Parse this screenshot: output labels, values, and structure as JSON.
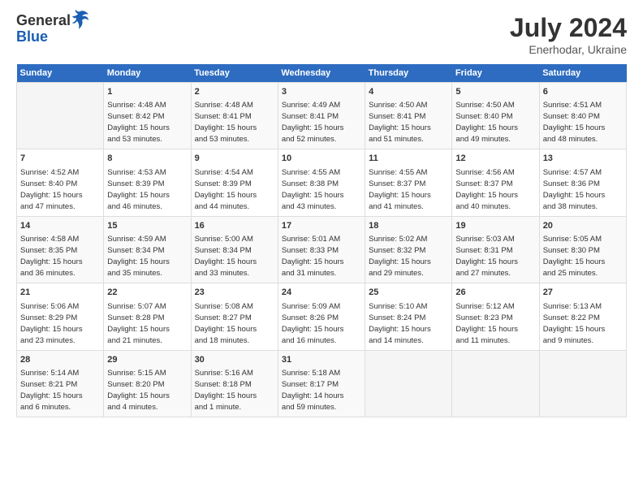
{
  "logo": {
    "general": "General",
    "blue": "Blue"
  },
  "title": "July 2024",
  "subtitle": "Enerhodar, Ukraine",
  "days_header": [
    "Sunday",
    "Monday",
    "Tuesday",
    "Wednesday",
    "Thursday",
    "Friday",
    "Saturday"
  ],
  "weeks": [
    [
      {
        "day": "",
        "detail": ""
      },
      {
        "day": "1",
        "detail": "Sunrise: 4:48 AM\nSunset: 8:42 PM\nDaylight: 15 hours\nand 53 minutes."
      },
      {
        "day": "2",
        "detail": "Sunrise: 4:48 AM\nSunset: 8:41 PM\nDaylight: 15 hours\nand 53 minutes."
      },
      {
        "day": "3",
        "detail": "Sunrise: 4:49 AM\nSunset: 8:41 PM\nDaylight: 15 hours\nand 52 minutes."
      },
      {
        "day": "4",
        "detail": "Sunrise: 4:50 AM\nSunset: 8:41 PM\nDaylight: 15 hours\nand 51 minutes."
      },
      {
        "day": "5",
        "detail": "Sunrise: 4:50 AM\nSunset: 8:40 PM\nDaylight: 15 hours\nand 49 minutes."
      },
      {
        "day": "6",
        "detail": "Sunrise: 4:51 AM\nSunset: 8:40 PM\nDaylight: 15 hours\nand 48 minutes."
      }
    ],
    [
      {
        "day": "7",
        "detail": "Sunrise: 4:52 AM\nSunset: 8:40 PM\nDaylight: 15 hours\nand 47 minutes."
      },
      {
        "day": "8",
        "detail": "Sunrise: 4:53 AM\nSunset: 8:39 PM\nDaylight: 15 hours\nand 46 minutes."
      },
      {
        "day": "9",
        "detail": "Sunrise: 4:54 AM\nSunset: 8:39 PM\nDaylight: 15 hours\nand 44 minutes."
      },
      {
        "day": "10",
        "detail": "Sunrise: 4:55 AM\nSunset: 8:38 PM\nDaylight: 15 hours\nand 43 minutes."
      },
      {
        "day": "11",
        "detail": "Sunrise: 4:55 AM\nSunset: 8:37 PM\nDaylight: 15 hours\nand 41 minutes."
      },
      {
        "day": "12",
        "detail": "Sunrise: 4:56 AM\nSunset: 8:37 PM\nDaylight: 15 hours\nand 40 minutes."
      },
      {
        "day": "13",
        "detail": "Sunrise: 4:57 AM\nSunset: 8:36 PM\nDaylight: 15 hours\nand 38 minutes."
      }
    ],
    [
      {
        "day": "14",
        "detail": "Sunrise: 4:58 AM\nSunset: 8:35 PM\nDaylight: 15 hours\nand 36 minutes."
      },
      {
        "day": "15",
        "detail": "Sunrise: 4:59 AM\nSunset: 8:34 PM\nDaylight: 15 hours\nand 35 minutes."
      },
      {
        "day": "16",
        "detail": "Sunrise: 5:00 AM\nSunset: 8:34 PM\nDaylight: 15 hours\nand 33 minutes."
      },
      {
        "day": "17",
        "detail": "Sunrise: 5:01 AM\nSunset: 8:33 PM\nDaylight: 15 hours\nand 31 minutes."
      },
      {
        "day": "18",
        "detail": "Sunrise: 5:02 AM\nSunset: 8:32 PM\nDaylight: 15 hours\nand 29 minutes."
      },
      {
        "day": "19",
        "detail": "Sunrise: 5:03 AM\nSunset: 8:31 PM\nDaylight: 15 hours\nand 27 minutes."
      },
      {
        "day": "20",
        "detail": "Sunrise: 5:05 AM\nSunset: 8:30 PM\nDaylight: 15 hours\nand 25 minutes."
      }
    ],
    [
      {
        "day": "21",
        "detail": "Sunrise: 5:06 AM\nSunset: 8:29 PM\nDaylight: 15 hours\nand 23 minutes."
      },
      {
        "day": "22",
        "detail": "Sunrise: 5:07 AM\nSunset: 8:28 PM\nDaylight: 15 hours\nand 21 minutes."
      },
      {
        "day": "23",
        "detail": "Sunrise: 5:08 AM\nSunset: 8:27 PM\nDaylight: 15 hours\nand 18 minutes."
      },
      {
        "day": "24",
        "detail": "Sunrise: 5:09 AM\nSunset: 8:26 PM\nDaylight: 15 hours\nand 16 minutes."
      },
      {
        "day": "25",
        "detail": "Sunrise: 5:10 AM\nSunset: 8:24 PM\nDaylight: 15 hours\nand 14 minutes."
      },
      {
        "day": "26",
        "detail": "Sunrise: 5:12 AM\nSunset: 8:23 PM\nDaylight: 15 hours\nand 11 minutes."
      },
      {
        "day": "27",
        "detail": "Sunrise: 5:13 AM\nSunset: 8:22 PM\nDaylight: 15 hours\nand 9 minutes."
      }
    ],
    [
      {
        "day": "28",
        "detail": "Sunrise: 5:14 AM\nSunset: 8:21 PM\nDaylight: 15 hours\nand 6 minutes."
      },
      {
        "day": "29",
        "detail": "Sunrise: 5:15 AM\nSunset: 8:20 PM\nDaylight: 15 hours\nand 4 minutes."
      },
      {
        "day": "30",
        "detail": "Sunrise: 5:16 AM\nSunset: 8:18 PM\nDaylight: 15 hours\nand 1 minute."
      },
      {
        "day": "31",
        "detail": "Sunrise: 5:18 AM\nSunset: 8:17 PM\nDaylight: 14 hours\nand 59 minutes."
      },
      {
        "day": "",
        "detail": ""
      },
      {
        "day": "",
        "detail": ""
      },
      {
        "day": "",
        "detail": ""
      }
    ]
  ]
}
